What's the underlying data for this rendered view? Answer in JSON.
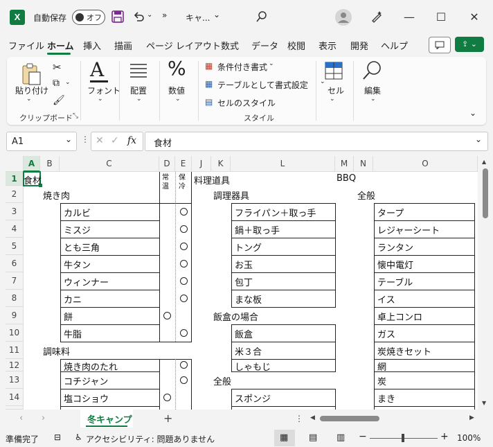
{
  "titlebar": {
    "autosave_label": "自動保存",
    "autosave_state": "オフ",
    "more": "»",
    "filename": "キャ...",
    "minimize": "—",
    "maximize": "☐",
    "close": "✕"
  },
  "ribbon_tabs": [
    "ファイル",
    "ホーム",
    "挿入",
    "描画",
    "ページ レイアウト",
    "数式",
    "データ",
    "校閲",
    "表示",
    "開発",
    "ヘルプ"
  ],
  "active_tab": "ホーム",
  "ribbon": {
    "paste": "貼り付け",
    "clipboard_group": "クリップボード",
    "font": "フォント",
    "alignment": "配置",
    "number": "数値",
    "conditional": "条件付き書式",
    "table_format": "テーブルとして書式設定",
    "cell_style": "セルのスタイル",
    "style_group": "スタイル",
    "cells": "セル",
    "editing": "編集"
  },
  "formula_bar": {
    "name_box": "A1",
    "fx": "fx",
    "content": "食材"
  },
  "columns": [
    "A",
    "B",
    "C",
    "D",
    "E",
    "J",
    "K",
    "L",
    "M",
    "N",
    "O"
  ],
  "rows": [
    "1",
    "2",
    "3",
    "4",
    "5",
    "6",
    "7",
    "8",
    "9",
    "10",
    "11",
    "12",
    "13",
    "14"
  ],
  "cells": {
    "a1": "食材",
    "b2": "焼き肉",
    "d1": "常温",
    "e1": "保冷",
    "j1": "料理道具",
    "k2": "調理器具",
    "m1": "BBQ",
    "n2": "全般",
    "c_list": [
      "カルビ",
      "ミスジ",
      "とも三角",
      "牛タン",
      "ウィンナー",
      "カニ",
      "餅",
      "牛脂"
    ],
    "b11": "調味料",
    "c_list2": [
      "焼き肉のたれ",
      "コチジャン",
      "塩コショウ"
    ],
    "l_list": [
      "フライパン＋取っ手",
      "鍋＋取っ手",
      "トング",
      "お玉",
      "包丁",
      "まな板"
    ],
    "k9": "飯盒の場合",
    "l_list2": [
      "飯盒",
      "米３合",
      "しゃもじ"
    ],
    "k13": "全般",
    "l14": "スポンジ",
    "o_list": [
      "タープ",
      "レジャーシート",
      "ランタン",
      "懐中電灯",
      "テーブル",
      "イス",
      "卓上コンロ",
      "ガス",
      "炭焼きセット",
      "網",
      "炭",
      "まき"
    ]
  },
  "sheet_tab": "冬キャンプ",
  "status": {
    "ready": "準備完了",
    "accessibility": "アクセシビリティ: 問題ありません",
    "zoom": "100%"
  }
}
